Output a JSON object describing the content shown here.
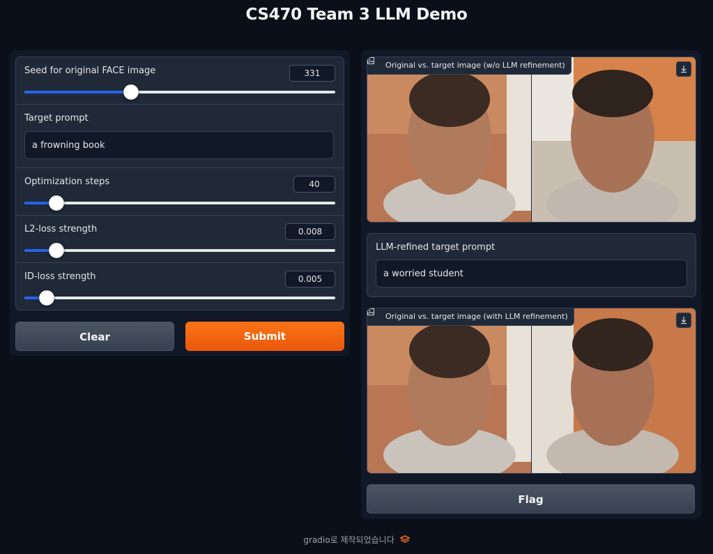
{
  "page": {
    "title": "CS470 Team 3 LLM Demo"
  },
  "inputs": {
    "seed": {
      "label": "Seed for original FACE image",
      "value": "331",
      "fraction": 0.34
    },
    "target_prompt": {
      "label": "Target prompt",
      "value": "a frowning book"
    },
    "steps": {
      "label": "Optimization steps",
      "value": "40",
      "fraction": 0.1
    },
    "l2": {
      "label": "L2-loss strength",
      "value": "0.008",
      "fraction": 0.1
    },
    "id": {
      "label": "ID-loss strength",
      "value": "0.005",
      "fraction": 0.07
    }
  },
  "buttons": {
    "clear": "Clear",
    "submit": "Submit",
    "flag": "Flag"
  },
  "outputs": {
    "image1_label": "Original vs. target image (w/o LLM refinement)",
    "refined_label": "LLM-refined target prompt",
    "refined_value": "a worried student",
    "image2_label": "Original vs. target image (with LLM refinement)"
  },
  "footer": {
    "text": "gradio로 제작되었습니다"
  },
  "colors": {
    "accent": "#f97316",
    "slider": "#2563eb",
    "background": "#0b0f19"
  }
}
